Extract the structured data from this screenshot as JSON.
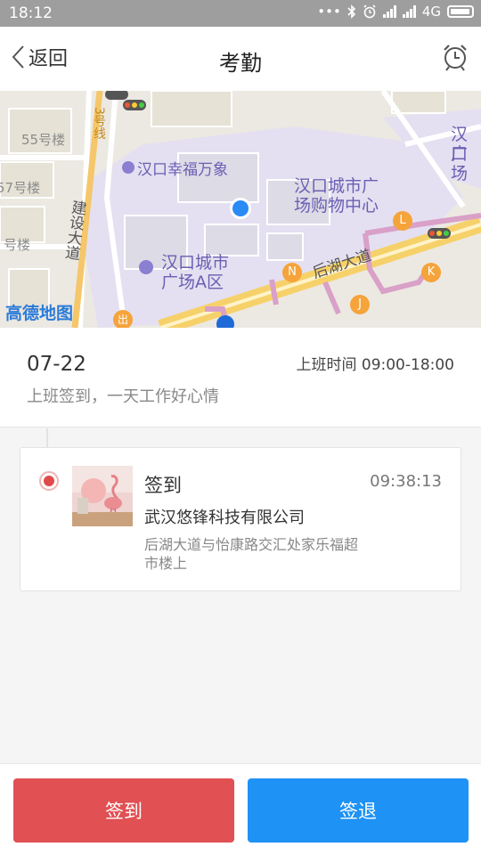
{
  "status_bar": {
    "time": "18:12",
    "dots": "•••",
    "bluetooth_icon": "bluetooth-icon",
    "alarm_icon": "alarm-icon",
    "network": "4G"
  },
  "header": {
    "back_label": "返回",
    "title": "考勤",
    "alarm_icon": "alarm-clock-icon"
  },
  "map": {
    "labels": {
      "poi_wanxiang": "汉口幸福万象",
      "mall_center_line1": "汉口城市广",
      "mall_center_line2": "场购物中心",
      "plaza_a_line1": "汉口城市",
      "plaza_a_line2": "广场A区",
      "corner_line1": "汉口",
      "corner_line2": "广场",
      "building_55": "55号楼",
      "building_57": "57号楼",
      "building_left": "号楼",
      "metro_line": "3号线",
      "road_jianshe": "建设大道",
      "road_houhu": "后湖大道",
      "logo": "高德地图"
    },
    "markers": [
      "L",
      "N",
      "K",
      "J",
      "出"
    ],
    "colors": {
      "location": "#2a8af6",
      "marker": "#f5a33b",
      "metro": "#d9a0c8"
    }
  },
  "attendance": {
    "date": "07-22",
    "work_time_label": "上班时间",
    "work_time_value": "09:00-18:00",
    "slogan": "上班签到，一天工作好心情"
  },
  "record": {
    "type": "签到",
    "time": "09:38:13",
    "company": "武汉悠锋科技有限公司",
    "address": "后湖大道与怡康路交汇处家乐福超市楼上",
    "status_color": "#e14a4a"
  },
  "actions": {
    "check_in_label": "签到",
    "check_out_label": "签退",
    "check_in_color": "#e15053",
    "check_out_color": "#1f92f5"
  }
}
